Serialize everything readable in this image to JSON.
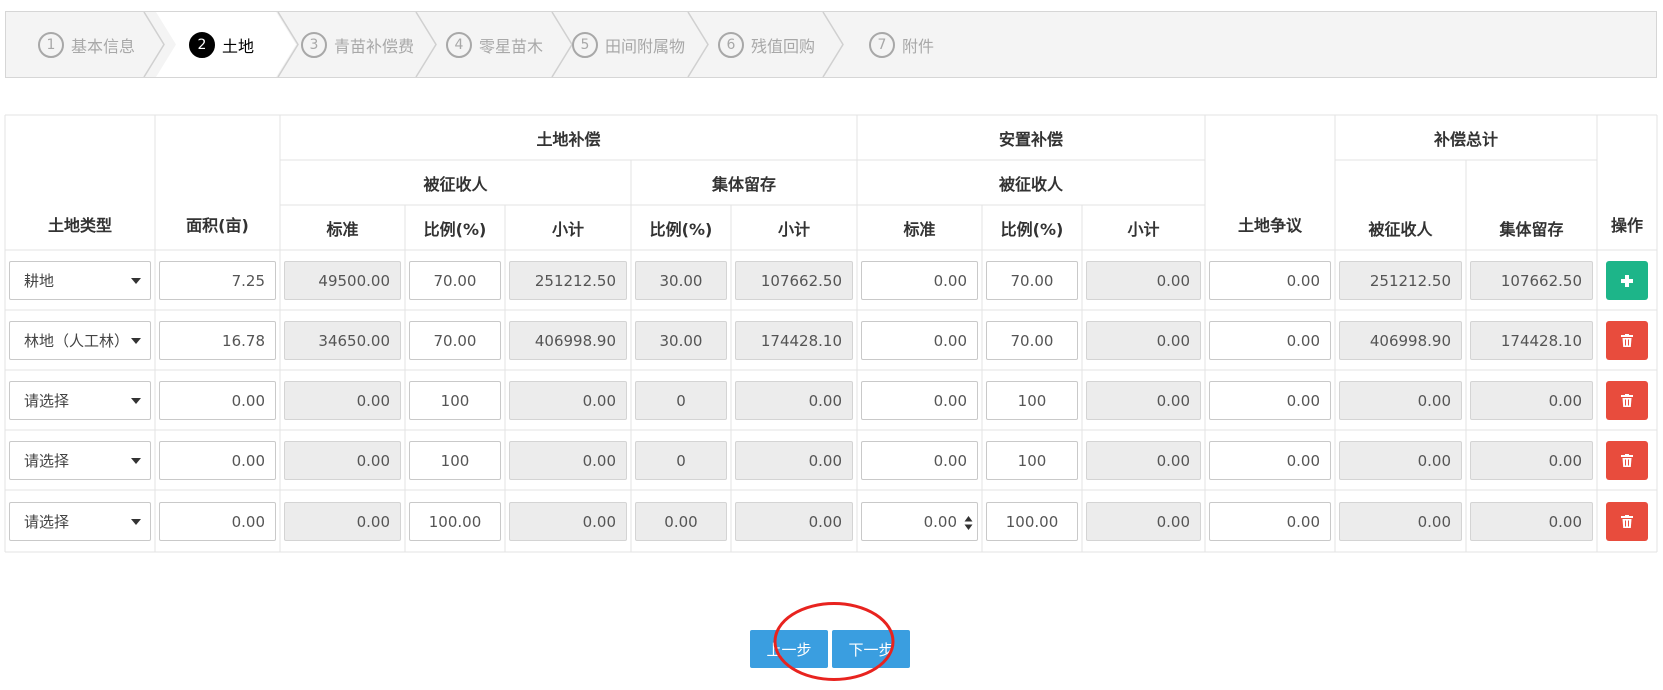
{
  "steps": [
    {
      "num": "1",
      "label": "基本信息",
      "active": false
    },
    {
      "num": "2",
      "label": "土地",
      "active": true
    },
    {
      "num": "3",
      "label": "青苗补偿费",
      "active": false
    },
    {
      "num": "4",
      "label": "零星苗木",
      "active": false
    },
    {
      "num": "5",
      "label": "田间附属物",
      "active": false
    },
    {
      "num": "6",
      "label": "残值回购",
      "active": false
    },
    {
      "num": "7",
      "label": "附件",
      "active": false
    }
  ],
  "table": {
    "headers": {
      "land_type": "土地类型",
      "area": "面积(亩)",
      "land_comp": "土地补偿",
      "resettle_comp": "安置补偿",
      "land_dispute": "土地争议",
      "comp_total": "补偿总计",
      "operation": "操作",
      "expropriated_1": "被征收人",
      "collective_1": "集体留存",
      "expropriated_2": "被征收人",
      "expropriated_3": "被征收人",
      "collective_3": "集体留存",
      "standard_1": "标准",
      "ratio_1": "比例(%)",
      "subtotal_1": "小计",
      "ratio_2": "比例(%)",
      "subtotal_2": "小计",
      "standard_3": "标准",
      "ratio_3": "比例(%)",
      "subtotal_3": "小计"
    },
    "rows": [
      {
        "type": "耕地",
        "area": "7.25",
        "std": "49500.00",
        "ratio": "70.00",
        "sub": "251212.50",
        "c_ratio": "30.00",
        "c_sub": "107662.50",
        "r_std": "0.00",
        "r_ratio": "70.00",
        "r_sub": "0.00",
        "dispute": "0.00",
        "t_exp": "251212.50",
        "t_col": "107662.50",
        "op": "add"
      },
      {
        "type": "林地（人工林）",
        "area": "16.78",
        "std": "34650.00",
        "ratio": "70.00",
        "sub": "406998.90",
        "c_ratio": "30.00",
        "c_sub": "174428.10",
        "r_std": "0.00",
        "r_ratio": "70.00",
        "r_sub": "0.00",
        "dispute": "0.00",
        "t_exp": "406998.90",
        "t_col": "174428.10",
        "op": "delete"
      },
      {
        "type": "请选择",
        "area": "0.00",
        "std": "0.00",
        "ratio": "100",
        "sub": "0.00",
        "c_ratio": "0",
        "c_sub": "0.00",
        "r_std": "0.00",
        "r_ratio": "100",
        "r_sub": "0.00",
        "dispute": "0.00",
        "t_exp": "0.00",
        "t_col": "0.00",
        "op": "delete"
      },
      {
        "type": "请选择",
        "area": "0.00",
        "std": "0.00",
        "ratio": "100",
        "sub": "0.00",
        "c_ratio": "0",
        "c_sub": "0.00",
        "r_std": "0.00",
        "r_ratio": "100",
        "r_sub": "0.00",
        "dispute": "0.00",
        "t_exp": "0.00",
        "t_col": "0.00",
        "op": "delete"
      },
      {
        "type": "请选择",
        "area": "0.00",
        "std": "0.00",
        "ratio": "100.00",
        "sub": "0.00",
        "c_ratio": "0.00",
        "c_sub": "0.00",
        "r_std": "0.00",
        "r_ratio": "100.00",
        "r_sub": "0.00",
        "dispute": "0.00",
        "t_exp": "0.00",
        "t_col": "0.00",
        "op": "delete"
      }
    ]
  },
  "buttons": {
    "prev": "上一步",
    "next": "下一步"
  },
  "colors": {
    "add": "#1db589",
    "delete": "#e84c3d",
    "nav": "#3a9ee0",
    "highlight_circle": "#e8231f"
  }
}
